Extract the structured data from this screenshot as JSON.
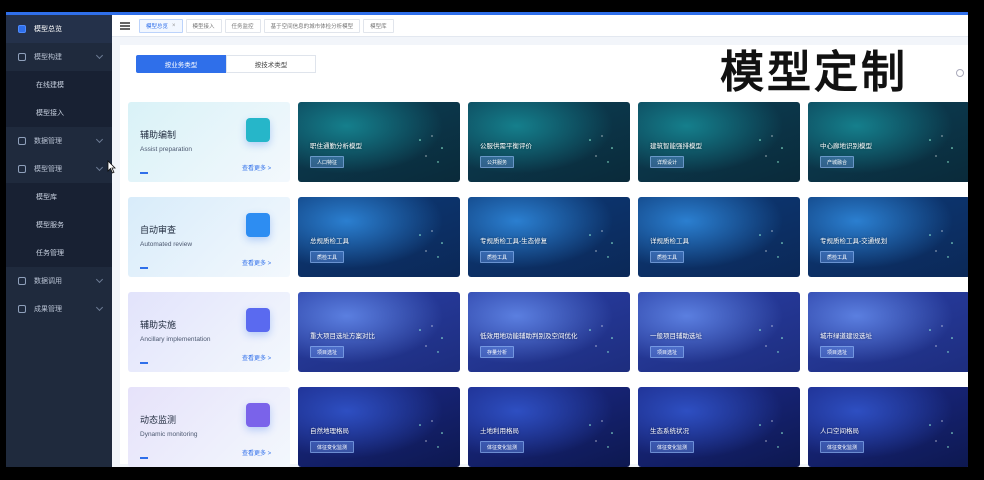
{
  "sidebar": {
    "items": [
      {
        "label": "模型总览",
        "active": true
      },
      {
        "label": "模型构建",
        "expandable": true
      },
      {
        "label": "在线建模",
        "sub": true
      },
      {
        "label": "模型接入",
        "sub": true
      },
      {
        "label": "数据管理",
        "expandable": true
      },
      {
        "label": "模型管理",
        "expandable": true
      },
      {
        "label": "模型库",
        "sub": true
      },
      {
        "label": "模型服务",
        "sub": true
      },
      {
        "label": "任务管理",
        "sub": true
      },
      {
        "label": "数据调用",
        "expandable": true
      },
      {
        "label": "成果管理",
        "expandable": true
      }
    ]
  },
  "tabs": [
    {
      "label": "模型总览",
      "active": true,
      "closable": true
    },
    {
      "label": "模型接入"
    },
    {
      "label": "任务监控"
    },
    {
      "label": "基于空间信息的城市体检分析模型"
    },
    {
      "label": "模型库"
    }
  ],
  "segment": {
    "active": "按业务类型",
    "inactive": "按技术类型"
  },
  "overlay_title": "模型定制",
  "more_label": "查看更多",
  "categories": [
    {
      "title": "辅助编制",
      "subtitle": "Assist preparation",
      "bg": "#d9f2f7",
      "icon_color": "#26b6c9",
      "cards": [
        {
          "title": "职住通勤分析模型",
          "tag": "人口特征"
        },
        {
          "title": "公服供需平衡评价",
          "tag": "公共服务"
        },
        {
          "title": "建筑智能强排模型",
          "tag": "详规设计"
        },
        {
          "title": "中心廊地识别模型",
          "tag": "产城融合"
        }
      ]
    },
    {
      "title": "自动审查",
      "subtitle": "Automated review",
      "bg": "#d8ecfa",
      "icon_color": "#2d8df2",
      "cards": [
        {
          "title": "总规质检工具",
          "tag": "质检工具"
        },
        {
          "title": "专规质检工具-生态修复",
          "tag": "质检工具"
        },
        {
          "title": "详规质检工具",
          "tag": "质检工具"
        },
        {
          "title": "专规质检工具-交通规划",
          "tag": "质检工具"
        }
      ]
    },
    {
      "title": "辅助实施",
      "subtitle": "Ancillary implementation",
      "bg": "#e2e3fb",
      "icon_color": "#5a6af0",
      "cards": [
        {
          "title": "重大项目选址方案对比",
          "tag": "项目选址"
        },
        {
          "title": "低效用地功能辅助判别及空间优化",
          "tag": "存量分析"
        },
        {
          "title": "一般项目辅助选址",
          "tag": "项目选址"
        },
        {
          "title": "城市绿道建设选址",
          "tag": "项目选址"
        }
      ]
    },
    {
      "title": "动态监测",
      "subtitle": "Dynamic monitoring",
      "bg": "#e6e2fa",
      "icon_color": "#7a63ea",
      "cards": [
        {
          "title": "自然地理格局",
          "tag": "体征变化监测"
        },
        {
          "title": "土地利用格局",
          "tag": "体征变化监测"
        },
        {
          "title": "生态系统状况",
          "tag": "体征变化监测"
        },
        {
          "title": "人口空间格局",
          "tag": "体征变化监测"
        }
      ]
    }
  ]
}
